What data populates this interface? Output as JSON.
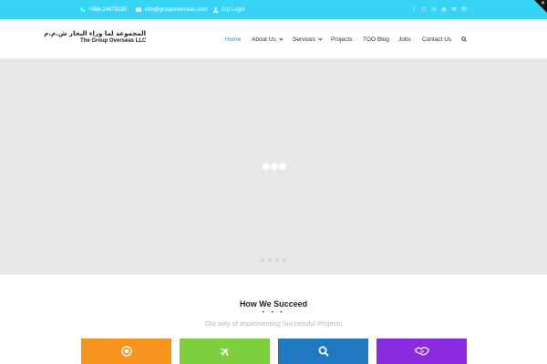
{
  "topbar": {
    "phone": "+968-24478280",
    "email": "info@groupoverseas.com",
    "erp": "Erp Login",
    "social_icons": [
      "facebook-icon",
      "instagram-icon",
      "linkedin-icon",
      "whatsapp-icon",
      "mail-icon",
      "phone-icon"
    ]
  },
  "logo": {
    "arabic": "المجموعة لما وراء البحار ش.م.م",
    "english": "The Group Overseas LLC"
  },
  "nav": {
    "home": "Home",
    "about": "About Us",
    "services": "Services",
    "projects": "Projects",
    "blog": "TGO Blog",
    "jobs": "Jobs",
    "contact": "Contact Us"
  },
  "section": {
    "title": "How We Succeed",
    "dots": "• • •",
    "subtitle": "Our way of implementing Successful Projects"
  },
  "cards": [
    {
      "icon": "target-icon",
      "color": "#f7941d"
    },
    {
      "icon": "airplane-icon",
      "color": "#7ed03f"
    },
    {
      "icon": "search-icon",
      "color": "#2079c0"
    },
    {
      "icon": "handshake-icon",
      "color": "#8a2be2"
    }
  ],
  "colors": {
    "topbar": "#37d4f5",
    "active_nav": "#2a8ed0",
    "hero_bg": "#e8e8e8"
  }
}
